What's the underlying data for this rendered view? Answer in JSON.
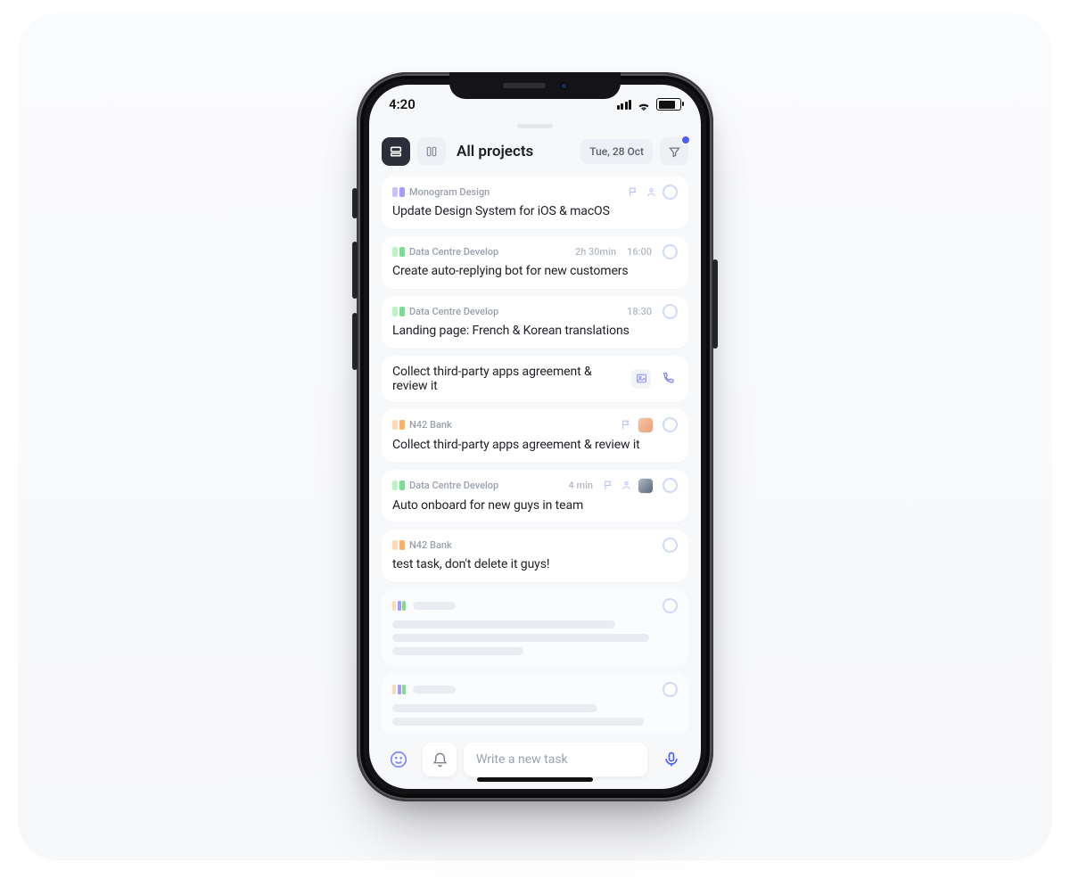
{
  "statusbar": {
    "time": "4:20"
  },
  "header": {
    "title": "All projects",
    "date": "Tue, 28 Oct"
  },
  "projects": {
    "monogram": "Monogram Design",
    "datacentre": "Data Centre Develop",
    "n42": "N42 Bank"
  },
  "tasks": [
    {
      "id": 0,
      "badge": "purple",
      "projectKey": "monogram",
      "title": "Update Design System for iOS & macOS",
      "meta": "",
      "features": [
        "flag",
        "assignee"
      ],
      "has_check": true
    },
    {
      "id": 1,
      "badge": "green",
      "projectKey": "datacentre",
      "title": "Create auto-replying bot for new customers",
      "meta": "2h 30min",
      "time": "16:00",
      "features": [],
      "has_check": true
    },
    {
      "id": 2,
      "badge": "green",
      "projectKey": "datacentre",
      "title": "Landing page: French & Korean translations",
      "time": "18:30",
      "features": [],
      "has_check": true
    },
    {
      "id": 3,
      "solo": true,
      "title": "Collect third-party apps agreement & review it",
      "chips": [
        "doc",
        "call"
      ]
    },
    {
      "id": 4,
      "badge": "orange",
      "projectKey": "n42",
      "title": "Collect third-party apps agreement & review it",
      "features": [
        "flag",
        "avatarA"
      ],
      "has_check": true
    },
    {
      "id": 5,
      "badge": "green",
      "projectKey": "datacentre",
      "title": "Auto onboard for new guys in team",
      "meta": "4 min",
      "features": [
        "flag",
        "assignee",
        "avatarB"
      ],
      "has_check": true
    },
    {
      "id": 6,
      "badge": "orange",
      "projectKey": "n42",
      "title": "test task, don't delete it guys!",
      "features": [],
      "has_check": true
    }
  ],
  "composer": {
    "placeholder": "Write a new task"
  }
}
